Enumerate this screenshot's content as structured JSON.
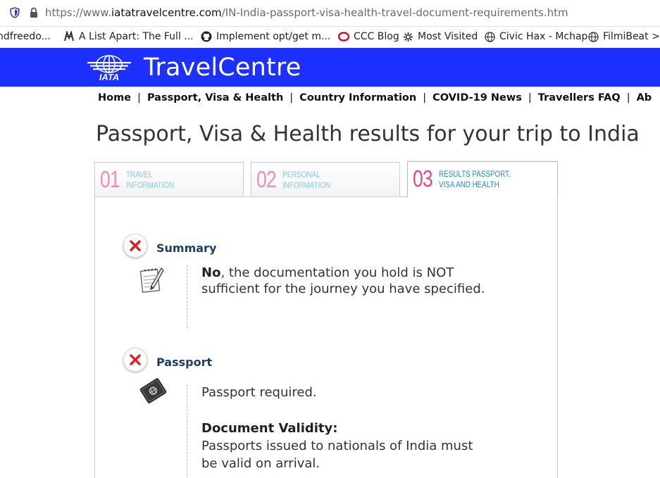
{
  "browser": {
    "url_prefix": "https://www.",
    "url_domain": "iatatravelcentre.com",
    "url_path": "/IN-India-passport-visa-health-travel-document-requirements.htm",
    "bookmarks": [
      {
        "label": "ndfreedo...",
        "icon": "page-icon"
      },
      {
        "label": "A List Apart: The Full ...",
        "icon": "alistapart-icon"
      },
      {
        "label": "Implement opt/get m...",
        "icon": "github-icon"
      },
      {
        "label": "CCC Blog",
        "icon": "ccc-icon"
      },
      {
        "label": "Most Visited",
        "icon": "gear-icon"
      },
      {
        "label": "Civic Hax - Mchap",
        "icon": "globe-icon"
      },
      {
        "label": "FilmiBeat >",
        "icon": "globe-icon"
      }
    ]
  },
  "header": {
    "logo_text": "IATA",
    "title": "TravelCentre",
    "color": "#1c30ff"
  },
  "nav": {
    "items": [
      "Home",
      "Passport, Visa & Health",
      "Country Information",
      "COVID-19 News",
      "Travellers FAQ",
      "Ab"
    ],
    "separator": "|"
  },
  "page": {
    "title": "Passport, Visa & Health results for your trip to India"
  },
  "steps": [
    {
      "num": "01",
      "line1": "Travel",
      "line2": "Information",
      "active": false
    },
    {
      "num": "02",
      "line1": "Personal",
      "line2": "Information",
      "active": false
    },
    {
      "num": "03",
      "line1": "Results Passport,",
      "line2": "Visa and Health",
      "active": true
    }
  ],
  "summary": {
    "title": "Summary",
    "status_icon": "red-x-icon",
    "answer": "No",
    "text": ", the documentation you hold is NOT sufficient for the journey you have specified."
  },
  "passport": {
    "title": "Passport",
    "status_icon": "red-x-icon",
    "required_text": "Passport required.",
    "validity_heading": "Document Validity:",
    "validity_text": "Passports issued to nationals of India must be valid on arrival."
  }
}
